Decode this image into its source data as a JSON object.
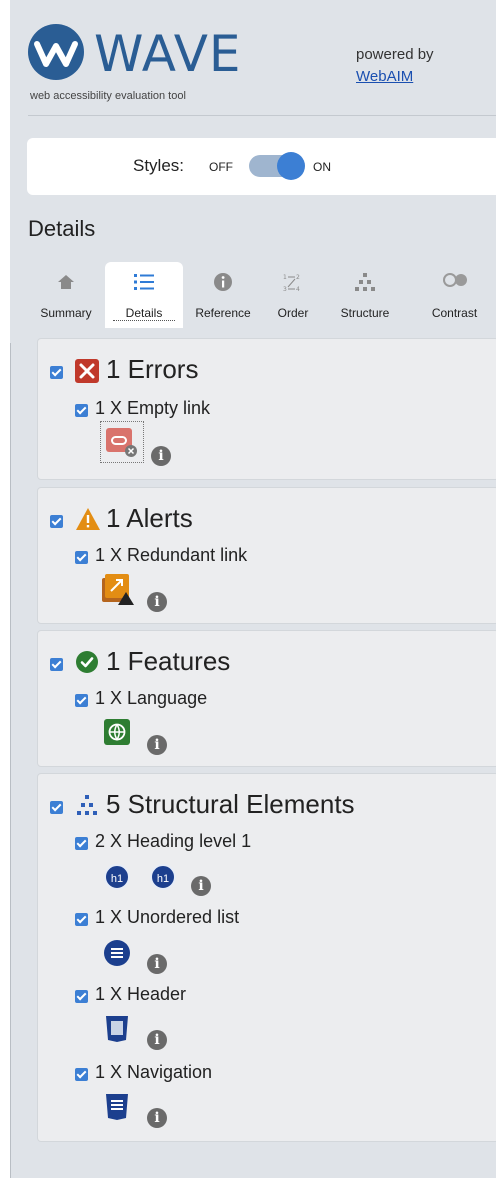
{
  "app": {
    "logo_text": "WAVE",
    "tagline": "web accessibility evaluation tool",
    "powered_by": "powered by",
    "powered_link": "WebAIM"
  },
  "styles_toggle": {
    "label": "Styles:",
    "off": "OFF",
    "on": "ON",
    "state": "on"
  },
  "details_title": "Details",
  "tabs": [
    {
      "label": "Summary",
      "icon": "home-icon"
    },
    {
      "label": "Details",
      "icon": "list-icon",
      "active": true
    },
    {
      "label": "Reference",
      "icon": "info-icon"
    },
    {
      "label": "Order",
      "icon": "order-icon"
    },
    {
      "label": "Structure",
      "icon": "structure-icon"
    },
    {
      "label": "Contrast",
      "icon": "contrast-icon"
    }
  ],
  "groups": {
    "errors": {
      "title": "1 Errors",
      "icon": "error-icon",
      "color": "#c0392b",
      "items": [
        {
          "label": "1 X Empty link",
          "icon": "empty-link-icon"
        }
      ]
    },
    "alerts": {
      "title": "1 Alerts",
      "icon": "alert-icon",
      "color": "#e38d13",
      "items": [
        {
          "label": "1 X Redundant link",
          "icon": "redundant-link-icon"
        }
      ]
    },
    "features": {
      "title": "1 Features",
      "icon": "feature-icon",
      "color": "#2e7d32",
      "items": [
        {
          "label": "1 X Language",
          "icon": "language-icon"
        }
      ]
    },
    "structure": {
      "title": "5 Structural Elements",
      "icon": "structure-icon",
      "color": "#2f5fb8",
      "items": [
        {
          "label": "2 X Heading level 1",
          "icon": "heading-icon",
          "badge": "h1"
        },
        {
          "label": "1 X Unordered list",
          "icon": "unordered-list-icon"
        },
        {
          "label": "1 X Header",
          "icon": "header-icon"
        },
        {
          "label": "1 X Navigation",
          "icon": "navigation-icon"
        }
      ]
    }
  },
  "colors": {
    "accent": "#3c7fd4",
    "navy": "#1c3f8e",
    "panel_bg": "#dfe3e8"
  }
}
